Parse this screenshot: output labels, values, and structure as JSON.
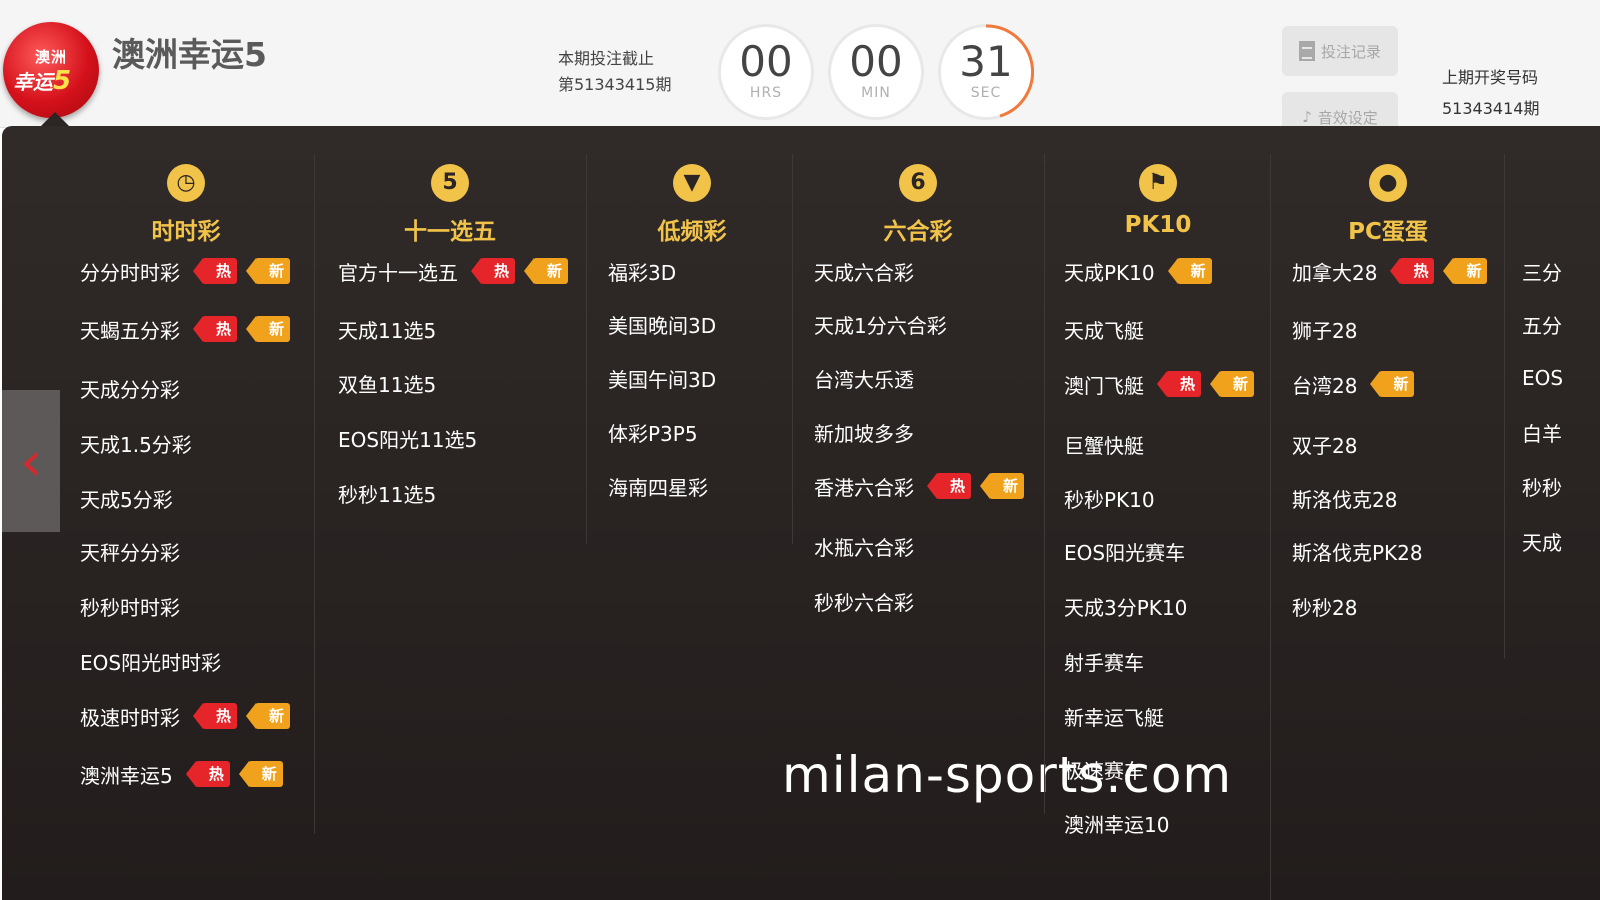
{
  "header": {
    "logo_line1": "澳洲",
    "logo_line2": "幸运",
    "logo_number": "5",
    "title": "澳洲幸运5",
    "deadline_label": "本期投注截止",
    "period": "第51343415期",
    "timer": {
      "hours": "00",
      "hours_unit": "HRS",
      "minutes": "00",
      "minutes_unit": "MIN",
      "seconds": "31",
      "seconds_unit": "SEC"
    },
    "bet_record_label": "投注记录",
    "sound_setting_label": "音效设定",
    "last_draw_label": "上期开奖号码",
    "last_draw_period": "51343414期"
  },
  "categories": [
    {
      "name": "时时彩",
      "icon": "clock-icon",
      "icon_glyph": "◷",
      "games": [
        {
          "name": "分分时时彩",
          "hot": true,
          "new": true
        },
        {
          "name": "天蝎五分彩",
          "hot": true,
          "new": true
        },
        {
          "name": "天成分分彩",
          "hot": false,
          "new": false
        },
        {
          "name": "天成1.5分彩",
          "hot": false,
          "new": false
        },
        {
          "name": "天成5分彩",
          "hot": false,
          "new": false
        },
        {
          "name": "天秤分分彩",
          "hot": false,
          "new": false
        },
        {
          "name": "秒秒时时彩",
          "hot": false,
          "new": false
        },
        {
          "name": "EOS阳光时时彩",
          "hot": false,
          "new": false
        },
        {
          "name": "极速时时彩",
          "hot": true,
          "new": true
        },
        {
          "name": "澳洲幸运5",
          "hot": true,
          "new": true
        }
      ]
    },
    {
      "name": "十一选五",
      "icon": "lottery-balls-icon",
      "icon_glyph": "5",
      "games": [
        {
          "name": "官方十一选五",
          "hot": true,
          "new": true
        },
        {
          "name": "天成11选5",
          "hot": false,
          "new": false
        },
        {
          "name": "双鱼11选5",
          "hot": false,
          "new": false
        },
        {
          "name": "EOS阳光11选5",
          "hot": false,
          "new": false
        },
        {
          "name": "秒秒11选5",
          "hot": false,
          "new": false
        }
      ]
    },
    {
      "name": "低频彩",
      "icon": "diamond-icon",
      "icon_glyph": "▼",
      "games": [
        {
          "name": "福彩3D",
          "hot": false,
          "new": false
        },
        {
          "name": "美国晚间3D",
          "hot": false,
          "new": false
        },
        {
          "name": "美国午间3D",
          "hot": false,
          "new": false
        },
        {
          "name": "体彩P3P5",
          "hot": false,
          "new": false
        },
        {
          "name": "海南四星彩",
          "hot": false,
          "new": false
        }
      ]
    },
    {
      "name": "六合彩",
      "icon": "six-ball-icon",
      "icon_glyph": "6",
      "games": [
        {
          "name": "天成六合彩",
          "hot": false,
          "new": false
        },
        {
          "name": "天成1分六合彩",
          "hot": false,
          "new": false
        },
        {
          "name": "台湾大乐透",
          "hot": false,
          "new": false
        },
        {
          "name": "新加坡多多",
          "hot": false,
          "new": false
        },
        {
          "name": "香港六合彩",
          "hot": true,
          "new": true
        },
        {
          "name": "水瓶六合彩",
          "hot": false,
          "new": false
        },
        {
          "name": "秒秒六合彩",
          "hot": false,
          "new": false
        }
      ]
    },
    {
      "name": "PK10",
      "icon": "checkered-flag-icon",
      "icon_glyph": "⚑",
      "games": [
        {
          "name": "天成PK10",
          "hot": false,
          "new": true
        },
        {
          "name": "天成飞艇",
          "hot": false,
          "new": false
        },
        {
          "name": "澳门飞艇",
          "hot": true,
          "new": true
        },
        {
          "name": "巨蟹快艇",
          "hot": false,
          "new": false
        },
        {
          "name": "秒秒PK10",
          "hot": false,
          "new": false
        },
        {
          "name": "EOS阳光赛车",
          "hot": false,
          "new": false
        },
        {
          "name": "天成3分PK10",
          "hot": false,
          "new": false
        },
        {
          "name": "射手赛车",
          "hot": false,
          "new": false
        },
        {
          "name": "新幸运飞艇",
          "hot": false,
          "new": false
        },
        {
          "name": "极速赛车",
          "hot": false,
          "new": false
        },
        {
          "name": "澳洲幸运10",
          "hot": false,
          "new": false
        }
      ]
    },
    {
      "name": "PC蛋蛋",
      "icon": "egg-icon",
      "icon_glyph": "●",
      "games": [
        {
          "name": "加拿大28",
          "hot": true,
          "new": true
        },
        {
          "name": "狮子28",
          "hot": false,
          "new": false
        },
        {
          "name": "台湾28",
          "hot": false,
          "new": true
        },
        {
          "name": "双子28",
          "hot": false,
          "new": false
        },
        {
          "name": "斯洛伐克28",
          "hot": false,
          "new": false
        },
        {
          "name": "斯洛伐克PK28",
          "hot": false,
          "new": false
        },
        {
          "name": "秒秒28",
          "hot": false,
          "new": false
        }
      ]
    },
    {
      "name": "",
      "icon": "",
      "icon_glyph": "",
      "games": [
        {
          "name": "三分",
          "hot": false,
          "new": false
        },
        {
          "name": "五分",
          "hot": false,
          "new": false
        },
        {
          "name": "EOS",
          "hot": false,
          "new": false
        },
        {
          "name": "白羊",
          "hot": false,
          "new": false
        },
        {
          "name": "秒秒",
          "hot": false,
          "new": false
        },
        {
          "name": "天成",
          "hot": false,
          "new": false
        }
      ]
    }
  ],
  "tags": {
    "hot": "热",
    "new": "新"
  },
  "prev_arrow_icon": "chevron-left-icon",
  "watermark": "milan-sports.com",
  "colors": {
    "accent_gold": "#f2c349",
    "hot_red": "#e5252a",
    "new_orange": "#f0a21c",
    "panel_bg": "#2b2523"
  }
}
